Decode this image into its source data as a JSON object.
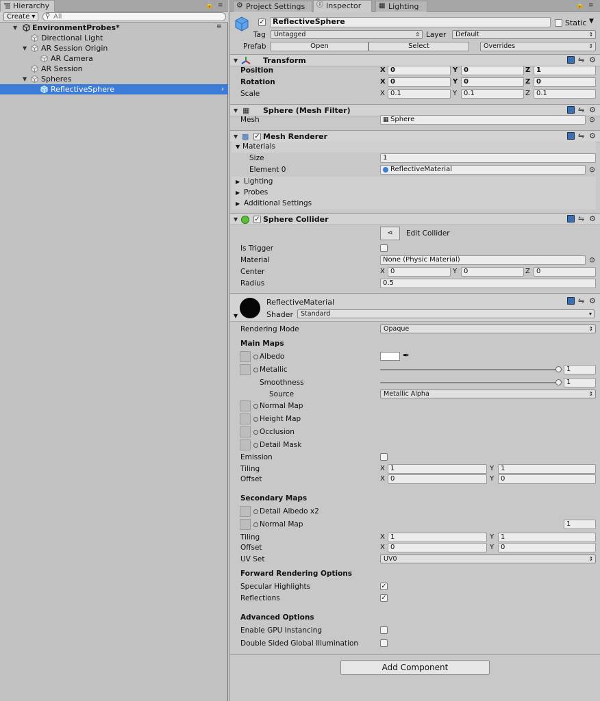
{
  "hierarchy": {
    "tab": "Hierarchy",
    "create": "Create",
    "search_placeholder": "All",
    "scene": "EnvironmentProbes*",
    "items": [
      {
        "label": "Directional Light"
      },
      {
        "label": "AR Session Origin"
      },
      {
        "label": "AR Camera"
      },
      {
        "label": "AR Session"
      },
      {
        "label": "Spheres"
      },
      {
        "label": "ReflectiveSphere"
      }
    ]
  },
  "tabs": [
    "Project Settings",
    "Inspector",
    "Lighting"
  ],
  "object": {
    "name": "ReflectiveSphere",
    "static_label": "Static",
    "tag_label": "Tag",
    "tag": "Untagged",
    "layer_label": "Layer",
    "layer": "Default",
    "prefab_label": "Prefab",
    "open": "Open",
    "select": "Select",
    "overrides": "Overrides"
  },
  "transform": {
    "title": "Transform",
    "rows": [
      {
        "label": "Position",
        "x": "0",
        "y": "0",
        "z": "1"
      },
      {
        "label": "Rotation",
        "x": "0",
        "y": "0",
        "z": "0"
      },
      {
        "label": "Scale",
        "x": "0.1",
        "y": "0.1",
        "z": "0.1"
      }
    ],
    "axes": [
      "X",
      "Y",
      "Z"
    ]
  },
  "mesh_filter": {
    "title": "Sphere (Mesh Filter)",
    "mesh_label": "Mesh",
    "mesh": "Sphere"
  },
  "mesh_renderer": {
    "title": "Mesh Renderer",
    "materials": "Materials",
    "size_label": "Size",
    "size": "1",
    "element_label": "Element 0",
    "element": "ReflectiveMaterial",
    "sections": [
      "Lighting",
      "Probes",
      "Additional Settings"
    ]
  },
  "sphere_collider": {
    "title": "Sphere Collider",
    "edit_collider": "Edit Collider",
    "is_trigger": "Is Trigger",
    "material_label": "Material",
    "material": "None (Physic Material)",
    "center_label": "Center",
    "center": {
      "x": "0",
      "y": "0",
      "z": "0"
    },
    "radius_label": "Radius",
    "radius": "0.5"
  },
  "material": {
    "name": "ReflectiveMaterial",
    "shader_label": "Shader",
    "shader": "Standard",
    "rendering_mode_label": "Rendering Mode",
    "rendering_mode": "Opaque",
    "main_maps": "Main Maps",
    "albedo": "Albedo",
    "metallic": "Metallic",
    "metallic_value": "1",
    "smoothness": "Smoothness",
    "smoothness_value": "1",
    "source_label": "Source",
    "source": "Metallic Alpha",
    "normal_map": "Normal Map",
    "height_map": "Height Map",
    "occlusion": "Occlusion",
    "detail_mask": "Detail Mask",
    "emission": "Emission",
    "tiling_label": "Tiling",
    "offset_label": "Offset",
    "tiling": {
      "x": "1",
      "y": "1"
    },
    "offset": {
      "x": "0",
      "y": "0"
    },
    "secondary_maps": "Secondary Maps",
    "detail_albedo": "Detail Albedo x2",
    "secondary_normal": "Normal Map",
    "secondary_normal_value": "1",
    "sec_tiling": {
      "x": "1",
      "y": "1"
    },
    "sec_offset": {
      "x": "0",
      "y": "0"
    },
    "uv_set_label": "UV Set",
    "uv_set": "UV0",
    "forward_rendering": "Forward Rendering Options",
    "specular_highlights": "Specular Highlights",
    "reflections": "Reflections",
    "advanced": "Advanced Options",
    "gpu_instancing": "Enable GPU Instancing",
    "double_sided_gi": "Double Sided Global Illumination"
  },
  "add_component": "Add Component",
  "colors": {
    "selection": "#3d7bd9",
    "panel": "#c8c8c8",
    "header": "#d3d3d3"
  }
}
